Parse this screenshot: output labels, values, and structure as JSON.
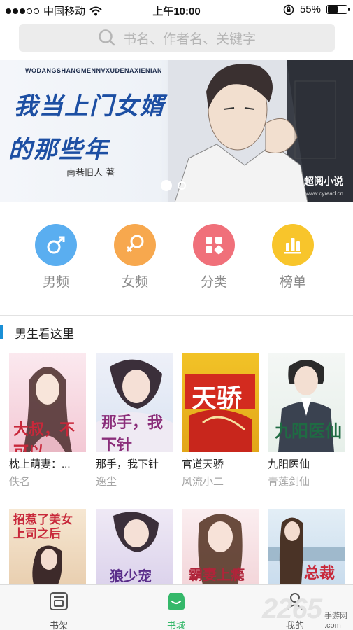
{
  "status_bar": {
    "carrier": "中国移动",
    "time": "上午10:00",
    "battery_text": "55%",
    "battery_level": 0.55
  },
  "search": {
    "placeholder": "书名、作者名、关键字"
  },
  "banner": {
    "pinyin": "WODANGSHANGMENNVXUDENAXIENIAN",
    "title_line1": "我当上门女婿",
    "title_line2": "的那些年",
    "author": "南巷旧人 著",
    "brand": "超阅小说",
    "site": "www.cyread.cn",
    "slide_count": 2,
    "active_slide": 1
  },
  "categories": [
    {
      "label": "男频",
      "icon": "male-icon",
      "color": "#5aaef0"
    },
    {
      "label": "女频",
      "icon": "female-icon",
      "color": "#f7a84e"
    },
    {
      "label": "分类",
      "icon": "category-icon",
      "color": "#f0707a"
    },
    {
      "label": "榜单",
      "icon": "ranking-icon",
      "color": "#f8c52b"
    }
  ],
  "section": {
    "title": "男生看这里"
  },
  "books_row1": [
    {
      "title": "枕上萌妻：...",
      "author": "佚名",
      "cover_text": "大叔，不可以"
    },
    {
      "title": "那手，我下针",
      "author": "逸尘",
      "cover_text": "那手，我下针"
    },
    {
      "title": "官道天骄",
      "author": "风流小二",
      "cover_text": "天骄"
    },
    {
      "title": "九阳医仙",
      "author": "青莲剑仙",
      "cover_text": "九阳医仙"
    }
  ],
  "books_row2": [
    {
      "cover_text": "招惹了美女上司之后"
    },
    {
      "cover_text": "狼少宠"
    },
    {
      "cover_text": "霸妻上瘾"
    },
    {
      "cover_text": "总裁"
    }
  ],
  "tab_bar": {
    "tabs": [
      {
        "label": "书架",
        "icon": "bookshelf-icon"
      },
      {
        "label": "书城",
        "icon": "bookstore-icon",
        "active": true
      },
      {
        "label": "我的",
        "icon": "profile-icon"
      }
    ]
  },
  "watermark": {
    "big": "2265",
    "small_top": "手游网",
    "small_bottom": ".com"
  },
  "colors": {
    "accent": "#35b86a",
    "section_bar": "#1a8fd6"
  }
}
